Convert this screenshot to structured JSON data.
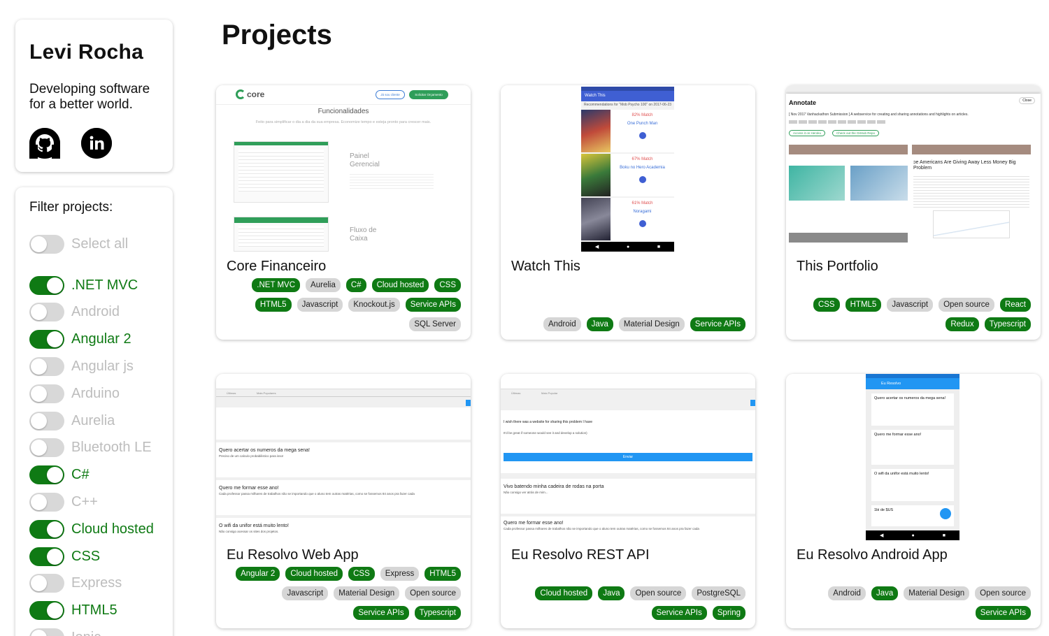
{
  "profile": {
    "name": "Levi Rocha",
    "tagline": "Developing software for a better world."
  },
  "filters": {
    "title": "Filter projects:",
    "select_all": {
      "label": "Select all",
      "on": false
    },
    "items": [
      {
        "label": ".NET MVC",
        "on": true
      },
      {
        "label": "Android",
        "on": false
      },
      {
        "label": "Angular 2",
        "on": true
      },
      {
        "label": "Angular js",
        "on": false
      },
      {
        "label": "Arduino",
        "on": false
      },
      {
        "label": "Aurelia",
        "on": false
      },
      {
        "label": "Bluetooth LE",
        "on": false
      },
      {
        "label": "C#",
        "on": true
      },
      {
        "label": "C++",
        "on": false
      },
      {
        "label": "Cloud hosted",
        "on": true
      },
      {
        "label": "CSS",
        "on": true
      },
      {
        "label": "Express",
        "on": false
      },
      {
        "label": "HTML5",
        "on": true
      },
      {
        "label": "Ionic",
        "on": false
      }
    ]
  },
  "main": {
    "title": "Projects",
    "projects": [
      {
        "name": "Core Financeiro",
        "tags": [
          {
            "label": ".NET MVC",
            "on": true
          },
          {
            "label": "Aurelia",
            "on": false
          },
          {
            "label": "C#",
            "on": true
          },
          {
            "label": "Cloud hosted",
            "on": true
          },
          {
            "label": "CSS",
            "on": true
          },
          {
            "label": "HTML5",
            "on": true
          },
          {
            "label": "Javascript",
            "on": false
          },
          {
            "label": "Knockout.js",
            "on": false
          },
          {
            "label": "Service APIs",
            "on": true
          },
          {
            "label": "SQL Server",
            "on": false
          }
        ]
      },
      {
        "name": "Watch This",
        "tags": [
          {
            "label": "Android",
            "on": false
          },
          {
            "label": "Java",
            "on": true
          },
          {
            "label": "Material Design",
            "on": false
          },
          {
            "label": "Service APIs",
            "on": true
          }
        ]
      },
      {
        "name": "This Portfolio",
        "tags": [
          {
            "label": "CSS",
            "on": true
          },
          {
            "label": "HTML5",
            "on": true
          },
          {
            "label": "Javascript",
            "on": false
          },
          {
            "label": "Open source",
            "on": false
          },
          {
            "label": "React",
            "on": true
          },
          {
            "label": "Redux",
            "on": true
          },
          {
            "label": "Typescript",
            "on": true
          }
        ]
      },
      {
        "name": "Eu Resolvo Web App",
        "tags": [
          {
            "label": "Angular 2",
            "on": true
          },
          {
            "label": "Cloud hosted",
            "on": true
          },
          {
            "label": "CSS",
            "on": true
          },
          {
            "label": "Express",
            "on": false
          },
          {
            "label": "HTML5",
            "on": true
          },
          {
            "label": "Javascript",
            "on": false
          },
          {
            "label": "Material Design",
            "on": false
          },
          {
            "label": "Open source",
            "on": false
          },
          {
            "label": "Service APIs",
            "on": true
          },
          {
            "label": "Typescript",
            "on": true
          }
        ]
      },
      {
        "name": "Eu Resolvo REST API",
        "tags": [
          {
            "label": "Cloud hosted",
            "on": true
          },
          {
            "label": "Java",
            "on": true
          },
          {
            "label": "Open source",
            "on": false
          },
          {
            "label": "PostgreSQL",
            "on": false
          },
          {
            "label": "Service APIs",
            "on": true
          },
          {
            "label": "Spring",
            "on": true
          }
        ]
      },
      {
        "name": "Eu Resolvo Android App",
        "tags": [
          {
            "label": "Android",
            "on": false
          },
          {
            "label": "Java",
            "on": true
          },
          {
            "label": "Material Design",
            "on": false
          },
          {
            "label": "Open source",
            "on": false
          },
          {
            "label": "Service APIs",
            "on": true
          }
        ]
      }
    ]
  },
  "thumbs": {
    "core": {
      "logo": "core",
      "heading": "Funcionalidades",
      "sub": "Feito para simplificar o dia a dia da sua empresa. Economize tempo e esteja pronto para crescer mais.",
      "f1": "Painel Gerencial",
      "f2": "Fluxo de Caixa",
      "btn1": "Já sou cliente",
      "btn2": "Solicitar Orçamento"
    },
    "watch": {
      "bar": "Watch This",
      "rec": "Recommendations for \"Mob Psycho 100\" on 2017-06-23",
      "items": [
        {
          "match": "82% Match",
          "title": "One Punch Man"
        },
        {
          "match": "67% Match",
          "title": "Boku no Hero Academia"
        },
        {
          "match": "61% Match",
          "title": "Noragami"
        }
      ]
    },
    "annotate": {
      "title": "Annotate",
      "close": "Close",
      "desc": "[ Nov 2017 Vanhackathon Submission ] A webservice for creating and sharing annotations and highlights on articles.",
      "b1": "Access it on Heroku",
      "b2": "Check out the GitHub Repo",
      "article": "ɔe Americans Are Giving Away Less Money Big Problem"
    },
    "web": {
      "tab1": "Últimas",
      "tab2": "Mais Populares",
      "q1": "Quero acertar os numeros da mega sena!",
      "d1": "Preciso de um calculo probabilistico para isso!",
      "q2": "Quero me formar esse ano!",
      "d2": "Cada professor passa milhares de trabalhos não se importando que o aluno tem outras matérias, como se fossemos 84 anos pra fazer cada",
      "q3": "O wifi da unifor está muito lento!",
      "d3": "Não consigo acessar os sites dos projetos."
    },
    "api": {
      "tab1": "Últimas",
      "tab2": "Mais Popular",
      "t1": "I wish there was a website for sharing this problem I have",
      "t2": "It'd be great if someone would see it and develop a solution)",
      "btn": "Enviar",
      "q1": "Vivo batendo minha cadeira de rodas na porta",
      "d1": "Não consigo ver atrás de mim...",
      "q2": "Quero me formar esse ano!",
      "d2": "Cada professor passa milhares de trabalhos não se importando que o aluno tem outras matérias, como se fossemos 84 anos pra fazer cada"
    },
    "android": {
      "bar": "Eu Resolvo",
      "q1": "Quero acertar os numeros da mega sena!",
      "q2": "Quero me formar esse ano!",
      "q3": "O wifi da unifor está muito lento!",
      "q4": "1bi de $US"
    }
  }
}
